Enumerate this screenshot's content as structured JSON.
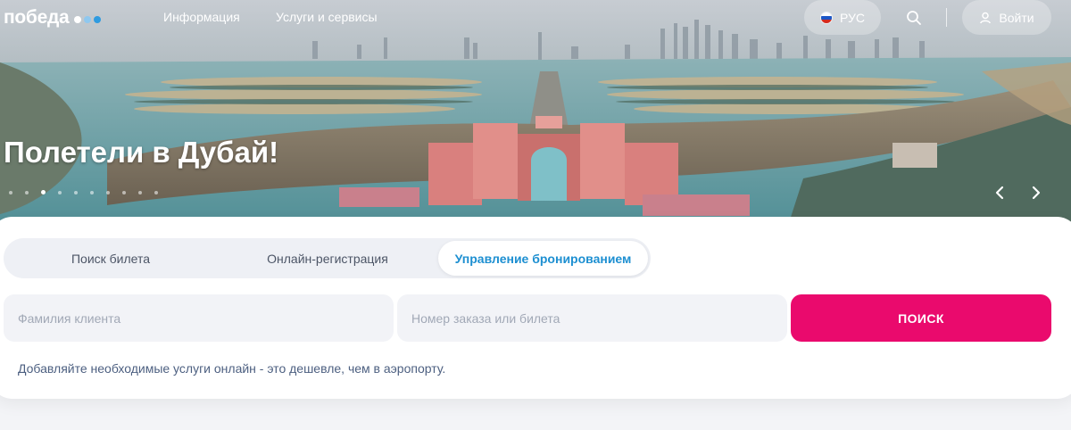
{
  "brand": {
    "logo_text": "победа",
    "dot_colors": [
      "#ffffff",
      "#8fc8ef",
      "#2f9be0"
    ]
  },
  "header": {
    "nav": [
      {
        "label": "Информация"
      },
      {
        "label": "Услуги и сервисы"
      }
    ],
    "language_label": "РУС",
    "login_label": "Войти"
  },
  "hero": {
    "title": "Полетели в Дубай!",
    "slide_count": 10,
    "active_slide": 3
  },
  "booking": {
    "tabs": [
      {
        "label": "Поиск билета",
        "active": false
      },
      {
        "label": "Онлайн-регистрация",
        "active": false
      },
      {
        "label": "Управление бронированием",
        "active": true
      }
    ],
    "surname_placeholder": "Фамилия клиента",
    "order_placeholder": "Номер заказа или билета",
    "search_label": "ПОИСК",
    "hint": "Добавляйте необходимые услуги онлайн - это дешевле, чем в аэропорту."
  },
  "colors": {
    "accent_pink": "#ea0a6d",
    "active_tab_text": "#1d8fd1"
  }
}
